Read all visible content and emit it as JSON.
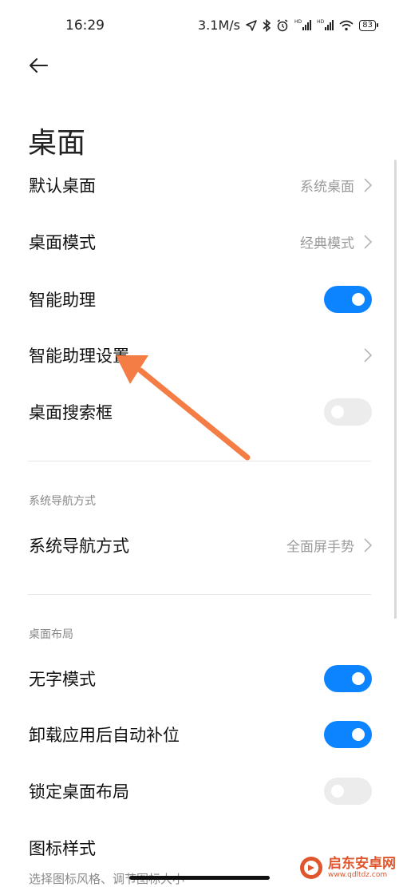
{
  "status_bar": {
    "time": "16:29",
    "network_speed": "3.1M/s",
    "battery_level": "83",
    "icons": [
      "location-arrow-icon",
      "bluetooth-icon",
      "alarm-icon",
      "hd-signal-icon",
      "hd-signal-icon",
      "wifi-icon",
      "battery-icon"
    ],
    "signal_badge": "HD"
  },
  "header": {
    "back_icon": "arrow-left-icon",
    "title": "桌面"
  },
  "section_main": {
    "rows": [
      {
        "label": "默认桌面",
        "value": "系统桌面",
        "type": "nav"
      },
      {
        "label": "桌面模式",
        "value": "经典模式",
        "type": "nav"
      },
      {
        "label": "智能助理",
        "type": "toggle",
        "on": true
      },
      {
        "label": "智能助理设置",
        "type": "nav"
      },
      {
        "label": "桌面搜索框",
        "type": "toggle",
        "on": false
      }
    ]
  },
  "section_nav": {
    "header": "系统导航方式",
    "rows": [
      {
        "label": "系统导航方式",
        "value": "全面屏手势",
        "type": "nav"
      }
    ]
  },
  "section_layout": {
    "header": "桌面布局",
    "rows": [
      {
        "label": "无字模式",
        "type": "toggle",
        "on": true
      },
      {
        "label": "卸载应用后自动补位",
        "type": "toggle",
        "on": true
      },
      {
        "label": "锁定桌面布局",
        "type": "toggle",
        "on": false
      },
      {
        "label": "图标样式",
        "sublabel": "选择图标风格、调节图标大小",
        "type": "nav"
      }
    ]
  },
  "annotation": {
    "icon": "orange-arrow-icon",
    "color": "#f47c45"
  },
  "watermark": {
    "name": "启东安卓网",
    "url": "www.qdltdz.com",
    "logo_icon": "watermark-logo-icon",
    "color": "#e0552b"
  },
  "colors": {
    "accent": "#0d84ff",
    "toggle_off": "#ececec",
    "value_text": "#9a9a9a"
  }
}
